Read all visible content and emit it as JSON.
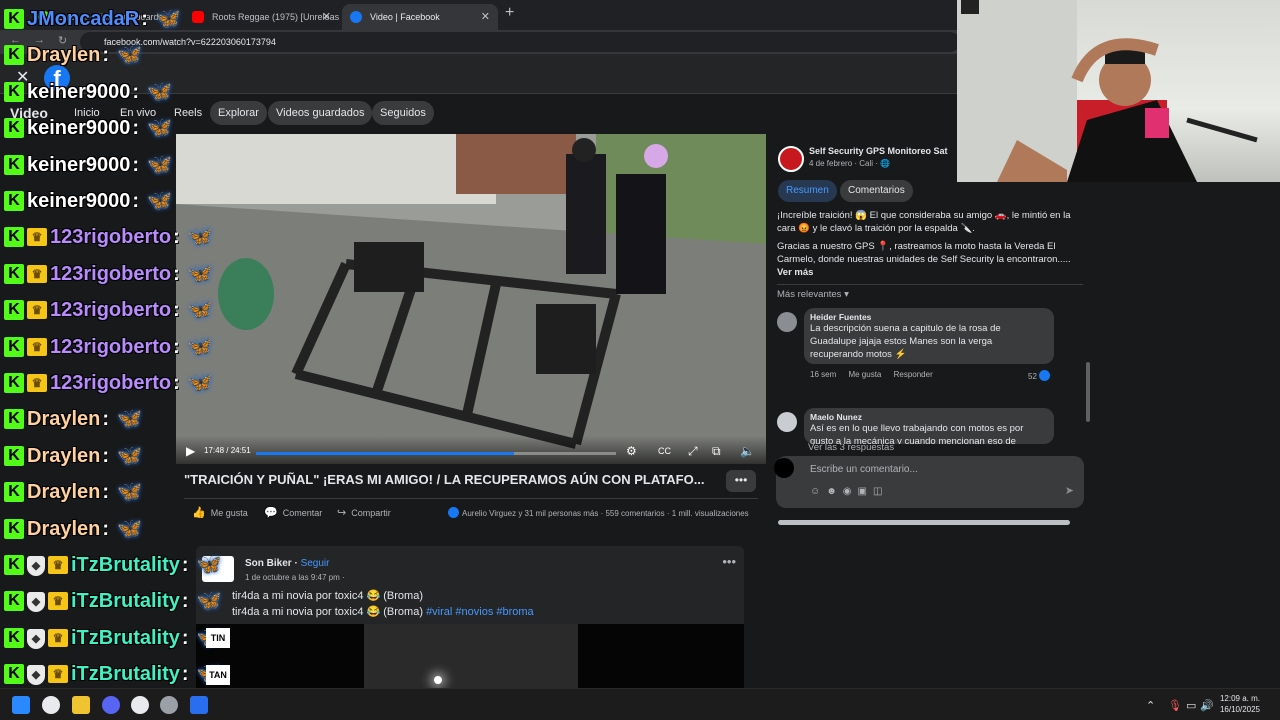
{
  "browser": {
    "tabs": [
      {
        "label": "Stream - Kick Dashboard"
      },
      {
        "label": "Roots Reggae (1975) [Unreleas"
      },
      {
        "label": "Video | Facebook"
      }
    ],
    "url": "facebook.com/watch?v=622203060173794"
  },
  "facebook": {
    "section_title": "Video",
    "nav": [
      "Inicio",
      "En vivo",
      "Reels",
      "Explorar",
      "Videos guardados",
      "Seguidos"
    ],
    "video": {
      "time": "17:48 / 24:51",
      "progress": 0.716
    },
    "post": {
      "title": "\"TRAICIÓN Y PUÑAL\" ¡ERAS MI AMIGO! / LA RECUPERAMOS AÚN CON PLATAFO...",
      "like_label": "Me gusta",
      "comment_label": "Comentar",
      "share_label": "Compartir",
      "reactions": "Aurelio Virguez y 31 mil personas más",
      "comments_count": "559 comentarios",
      "views": "1 mill. visualizaciones"
    },
    "page": {
      "name": "Self Security GPS Monitoreo Sat",
      "meta": "4 de febrero · Cali ·"
    },
    "tabs": [
      "Resumen",
      "Comentarios"
    ],
    "description": {
      "p1": "¡Increíble traición! 😱 El que consideraba su amigo 🚗, le mintió en la cara 😡 y le clavó la traición por la espalda 🔪.",
      "p2": "Gracias a nuestro GPS 📍, rastreamos la moto hasta la Vereda El Carmelo, donde nuestras unidades de Self Security la encontraron.....",
      "more": "Ver más"
    },
    "relevant_label": "Más relevantes",
    "comments": [
      {
        "name": "Heider Fuentes",
        "text": "La descripción suena a capitulo de la rosa de Guadalupe jajaja estos Manes son la verga recuperando motos ⚡",
        "time": "16 sem",
        "like": "Me gusta",
        "reply": "Responder",
        "likes": "52"
      },
      {
        "name": "Maelo Nunez",
        "text": "Así es en lo que llevo trabajando con motos es por gusto a la mecánica y cuando mencionan eso de"
      }
    ],
    "replies_label": "Ver las 3 respuestas",
    "compose_placeholder": "Escribe un comentario...",
    "post2": {
      "author": "Son Biker",
      "follow": "Seguir",
      "date": "1 de octubre a las 9:47 pm ·",
      "line1": "tir4da a mi novia por toxic4 😂 (Broma)",
      "line2_text": "tir4da a mi novia por toxic4 😂 (Broma)",
      "tags": "#viral #novios #broma"
    }
  },
  "chat": [
    {
      "user": "JMoncadaR",
      "color": "#4f8dff",
      "crown": false,
      "shield": false
    },
    {
      "user": "Draylen",
      "color": "#ffd0a0",
      "crown": false,
      "shield": false
    },
    {
      "user": "keiner9000",
      "color": "#ffffff",
      "crown": false,
      "shield": false
    },
    {
      "user": "keiner9000",
      "color": "#ffffff",
      "crown": false,
      "shield": false
    },
    {
      "user": "keiner9000",
      "color": "#ffffff",
      "crown": false,
      "shield": false
    },
    {
      "user": "keiner9000",
      "color": "#ffffff",
      "crown": false,
      "shield": false
    },
    {
      "user": "123rigoberto",
      "color": "#b98bff",
      "crown": true,
      "shield": false
    },
    {
      "user": "123rigoberto",
      "color": "#b98bff",
      "crown": true,
      "shield": false
    },
    {
      "user": "123rigoberto",
      "color": "#b98bff",
      "crown": true,
      "shield": false
    },
    {
      "user": "123rigoberto",
      "color": "#b98bff",
      "crown": true,
      "shield": false
    },
    {
      "user": "123rigoberto",
      "color": "#b98bff",
      "crown": true,
      "shield": false
    },
    {
      "user": "Draylen",
      "color": "#ffd0a0",
      "crown": false,
      "shield": false
    },
    {
      "user": "Draylen",
      "color": "#ffd0a0",
      "crown": false,
      "shield": false
    },
    {
      "user": "Draylen",
      "color": "#ffd0a0",
      "crown": false,
      "shield": false
    },
    {
      "user": "Draylen",
      "color": "#ffd0a0",
      "crown": false,
      "shield": false
    },
    {
      "user": "iTzBrutality",
      "color": "#43f0c2",
      "crown": true,
      "shield": true
    },
    {
      "user": "iTzBrutality",
      "color": "#43f0c2",
      "crown": true,
      "shield": true
    },
    {
      "user": "iTzBrutality",
      "color": "#43f0c2",
      "crown": true,
      "shield": true
    },
    {
      "user": "iTzBrutality",
      "color": "#43f0c2",
      "crown": true,
      "shield": true
    }
  ],
  "chat_side_badges": [
    "TIN",
    "TAN"
  ],
  "taskbar": {
    "time": "12:09 a. m.",
    "date": "16/10/2025"
  }
}
